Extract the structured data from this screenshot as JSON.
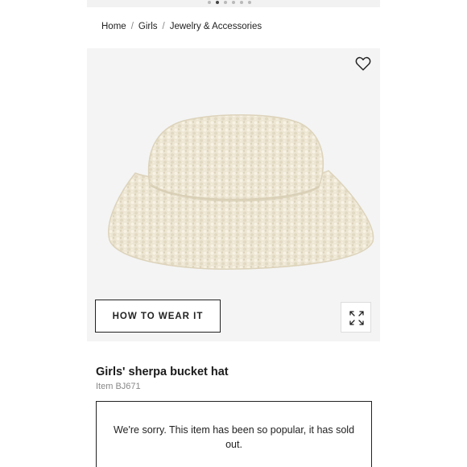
{
  "carousel": {
    "dot_count": 6,
    "active_index": 1
  },
  "breadcrumb": {
    "items": [
      "Home",
      "Girls",
      "Jewelry & Accessories"
    ],
    "separator": "/"
  },
  "gallery": {
    "favorite_icon": "heart-outline-icon",
    "how_to_wear_label": "HOW TO WEAR IT",
    "zoom_icon": "expand-arrows-icon"
  },
  "product": {
    "title": "Girls' sherpa bucket hat",
    "item_number": "Item BJ671",
    "sold_out_message": "We're sorry. This item has been so popular, it has sold out."
  },
  "colors": {
    "background": "#ffffff",
    "image_background": "#f4f4f4",
    "hat": "#ede6d3",
    "text": "#222222",
    "muted": "#888888"
  }
}
